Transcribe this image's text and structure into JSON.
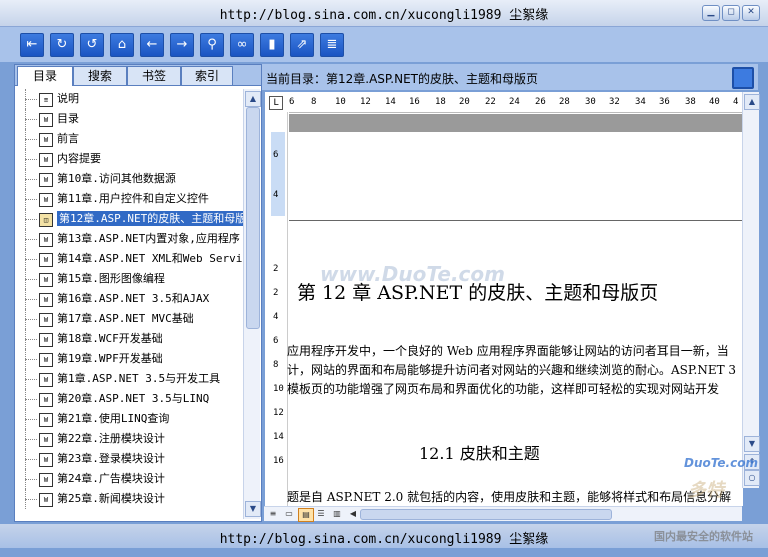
{
  "window": {
    "title": "http://blog.sina.com.cn/xucongli1989    尘絮缘",
    "controls": [
      "minimize",
      "restore",
      "close"
    ]
  },
  "toolbar": {
    "icons": [
      "open-icon",
      "refresh-icon",
      "back-rotate-icon",
      "home-icon",
      "arrow-left-icon",
      "arrow-right-icon",
      "search-icon",
      "link-icon",
      "bookmark-icon",
      "export-icon",
      "notes-icon"
    ]
  },
  "left_panel": {
    "tabs": [
      "目录",
      "搜索",
      "书签",
      "索引"
    ],
    "items": [
      {
        "label": "说明",
        "icon": "page-icon"
      },
      {
        "label": "目录",
        "icon": "doc-icon"
      },
      {
        "label": "前言",
        "icon": "doc-icon"
      },
      {
        "label": "内容提要",
        "icon": "doc-icon"
      },
      {
        "label": "第10章.访问其他数据源",
        "icon": "doc-icon"
      },
      {
        "label": "第11章.用户控件和自定义控件",
        "icon": "doc-icon"
      },
      {
        "label": "第12章.ASP.NET的皮肤、主题和母版页",
        "icon": "book-open-icon",
        "selected": true
      },
      {
        "label": "第13章.ASP.NET内置对象,应用程序",
        "icon": "doc-icon"
      },
      {
        "label": "第14章.ASP.NET XML和Web Services",
        "icon": "doc-icon"
      },
      {
        "label": "第15章.图形图像编程",
        "icon": "doc-icon"
      },
      {
        "label": "第16章.ASP.NET 3.5和AJAX",
        "icon": "doc-icon"
      },
      {
        "label": "第17章.ASP.NET MVC基础",
        "icon": "doc-icon"
      },
      {
        "label": "第18章.WCF开发基础",
        "icon": "doc-icon"
      },
      {
        "label": "第19章.WPF开发基础",
        "icon": "doc-icon"
      },
      {
        "label": "第1章.ASP.NET 3.5与开发工具",
        "icon": "doc-icon"
      },
      {
        "label": "第20章.ASP.NET 3.5与LINQ",
        "icon": "doc-icon"
      },
      {
        "label": "第21章.使用LINQ查询",
        "icon": "doc-icon"
      },
      {
        "label": "第22章.注册模块设计",
        "icon": "doc-icon"
      },
      {
        "label": "第23章.登录模块设计",
        "icon": "doc-icon"
      },
      {
        "label": "第24章.广告模块设计",
        "icon": "doc-icon"
      },
      {
        "label": "第25章.新闻模块设计",
        "icon": "doc-icon"
      }
    ]
  },
  "right_panel": {
    "current_dir": "当前目录：第12章.ASP.NET的皮肤、主题和母版页",
    "ruler_ticks": [
      "6",
      "8",
      "10",
      "12",
      "14",
      "16",
      "18",
      "20",
      "22",
      "24",
      "26",
      "28",
      "30",
      "32",
      "34",
      "36",
      "38",
      "40",
      "4"
    ],
    "vruler_ticks": [
      "6",
      "4",
      "2",
      "2",
      "4",
      "6",
      "8",
      "10",
      "12",
      "14",
      "16"
    ],
    "doc": {
      "heading": "第 12 章    ASP.NET 的皮肤、主题和母版页",
      "paragraph": [
        "应用程序开发中，一个良好的 Web 应用程序界面能够让网站的访问者耳目一新，当",
        "计，网站的界面和布局能够提升访问者对网站的兴趣和继续浏览的耐心。ASP.NET 3",
        "模板页的功能增强了网页布局和界面优化的功能，这样即可轻松的实现对网站开发",
        "题是自 ASP.NET 2.0 就包括的内容，使用皮肤和主题，能够将样式和布局信息分解"
      ],
      "subheading": "12.1    皮肤和主题"
    }
  },
  "status": {
    "text": "http://blog.sina.com.cn/xucongli1989    尘絮缘"
  },
  "watermarks": [
    "www.DuoTe.com",
    "DuoTe.com",
    "多特",
    "国内最安全的软件站"
  ]
}
